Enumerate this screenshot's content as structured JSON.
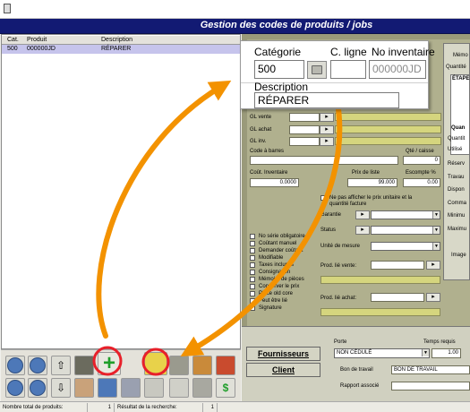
{
  "window": {
    "icon": "document-icon"
  },
  "header": {
    "title": "Gestion des codes de produits / jobs"
  },
  "list": {
    "columns": [
      "Cat.",
      "Produit",
      "Description"
    ],
    "rows": [
      {
        "cat": "500",
        "produit": "000000JD",
        "description": "RÉPARER"
      }
    ]
  },
  "callout": {
    "categorie_label": "Catégorie",
    "categorie_value": "500",
    "cligne_label": "C. ligne",
    "noinventaire_label": "No inventaire",
    "noinventaire_value": "000000JD",
    "description_label": "Description",
    "description_value": "RÉPARER"
  },
  "form": {
    "gl_vente": "GL vente",
    "gl_achat": "GL achat",
    "gl_inv": "GL inv.",
    "code_barres": "Code à barres",
    "qte_caisse": "Qté / caisse",
    "qte_caisse_value": "0",
    "cout_inventaire": "Coût. Inventaire",
    "cout_inventaire_value": "0.0000",
    "prix_liste": "Prix de liste",
    "prix_liste_value": "99.000",
    "escompte": "Escompte %",
    "escompte_value": "0.00",
    "ne_pas_afficher": "Ne pas afficher le prix unitaire et la quantité facture",
    "garantie": "Garantie",
    "status": "Status",
    "unite_mesure": "Unité de mesure",
    "prod_lie_vente": "Prod. lié vente:",
    "prod_lie_achat": "Prod. lié achat:",
    "checkboxes": [
      "No série obligatoire",
      "Coûtant manuel",
      "Demander coûtant",
      "Modifiable",
      "Taxes incluses",
      "Consignation",
      "Mémoire de pièces",
      "Conserver le prix",
      "Pièce old core",
      "Peut être lié",
      "Signature"
    ]
  },
  "right_column": {
    "memo": "Mémo",
    "quantite": "Quantité",
    "etape": "ÉTAPE",
    "quan": "Quan",
    "labels": [
      "Quantit",
      "Utilisé",
      "Réserv",
      "Travau",
      "Dispon",
      "Comma",
      "Minimu",
      "Maximu"
    ],
    "image": "Image"
  },
  "bottom": {
    "fournisseurs": "Fournisseurs",
    "client": "Client",
    "porte_label": "Porte",
    "porte_value": "NON CÉDULÉ",
    "temps_label": "Temps requis",
    "temps_value": "1.00",
    "bon_travail_label": "Bon de travail",
    "bon_travail_value": "BON DE TRAVAIL",
    "rapport_label": "Rapport associé"
  },
  "status": {
    "total_label": "Nombre total de produits:",
    "total_value": "1",
    "resultat_label": "Résultat de la recherche:",
    "resultat_value": "1"
  },
  "colors": {
    "header_bg": "#121a73",
    "annotation": "#f39200",
    "highlight": "#e8202a",
    "panel": "#b0b08e"
  }
}
